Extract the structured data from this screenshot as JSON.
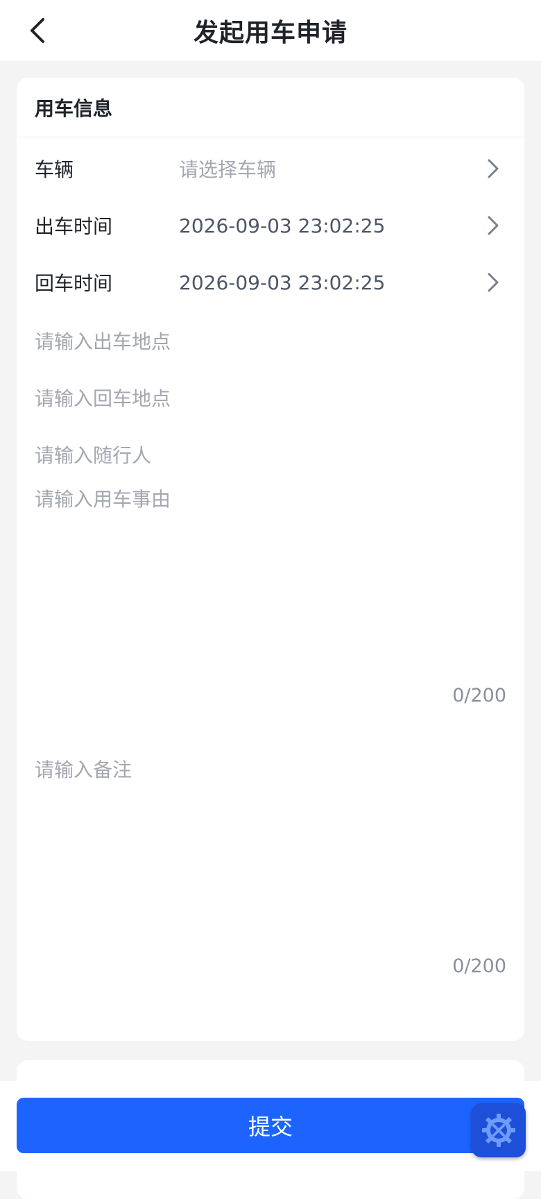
{
  "nav": {
    "title": "发起用车申请",
    "back_icon": "chevron-left-icon"
  },
  "section": {
    "title": "用车信息"
  },
  "fields": {
    "vehicle": {
      "label": "车辆",
      "placeholder": "请选择车辆"
    },
    "depart_time": {
      "label": "出车时间",
      "value": "2026-09-03 23:02:25"
    },
    "return_time": {
      "label": "回车时间",
      "value": "2026-09-03 23:02:25"
    },
    "depart_place": {
      "placeholder": "请输入出车地点"
    },
    "return_place": {
      "placeholder": "请输入回车地点"
    },
    "companions": {
      "placeholder": "请输入随行人"
    },
    "reason": {
      "placeholder": "请输入用车事由",
      "count": "0/200"
    },
    "remark": {
      "placeholder": "请输入备注",
      "count": "0/200"
    }
  },
  "footer": {
    "submit_label": "提交"
  },
  "fab": {
    "icon": "tools-gear-icon"
  },
  "colors": {
    "primary": "#1d64ff",
    "placeholder": "#a3a7b0",
    "background": "#f4f4f5"
  }
}
